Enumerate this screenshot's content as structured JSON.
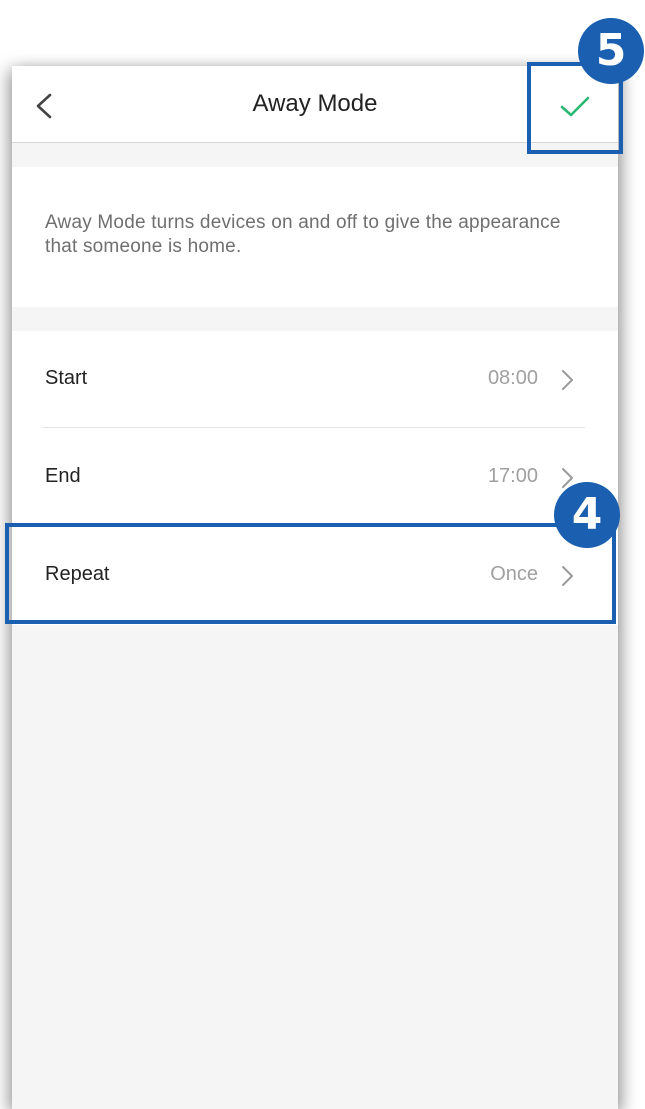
{
  "header": {
    "title": "Away Mode",
    "back_icon": "chevron-left-icon",
    "confirm_icon": "checkmark-icon",
    "confirm_color": "#2bb673"
  },
  "description": "Away Mode turns devices on and off to give the appearance that someone is home.",
  "settings": [
    {
      "label": "Start",
      "value": "08:00"
    },
    {
      "label": "End",
      "value": "17:00"
    },
    {
      "label": "Repeat",
      "value": "Once"
    }
  ],
  "annotations": [
    {
      "number": "5",
      "target": "confirm-button"
    },
    {
      "number": "4",
      "target": "repeat-row"
    }
  ],
  "colors": {
    "accent": "#1a5fb0",
    "check": "#2bb673",
    "value_text": "#a0a0a0",
    "background": "#f5f5f5"
  }
}
